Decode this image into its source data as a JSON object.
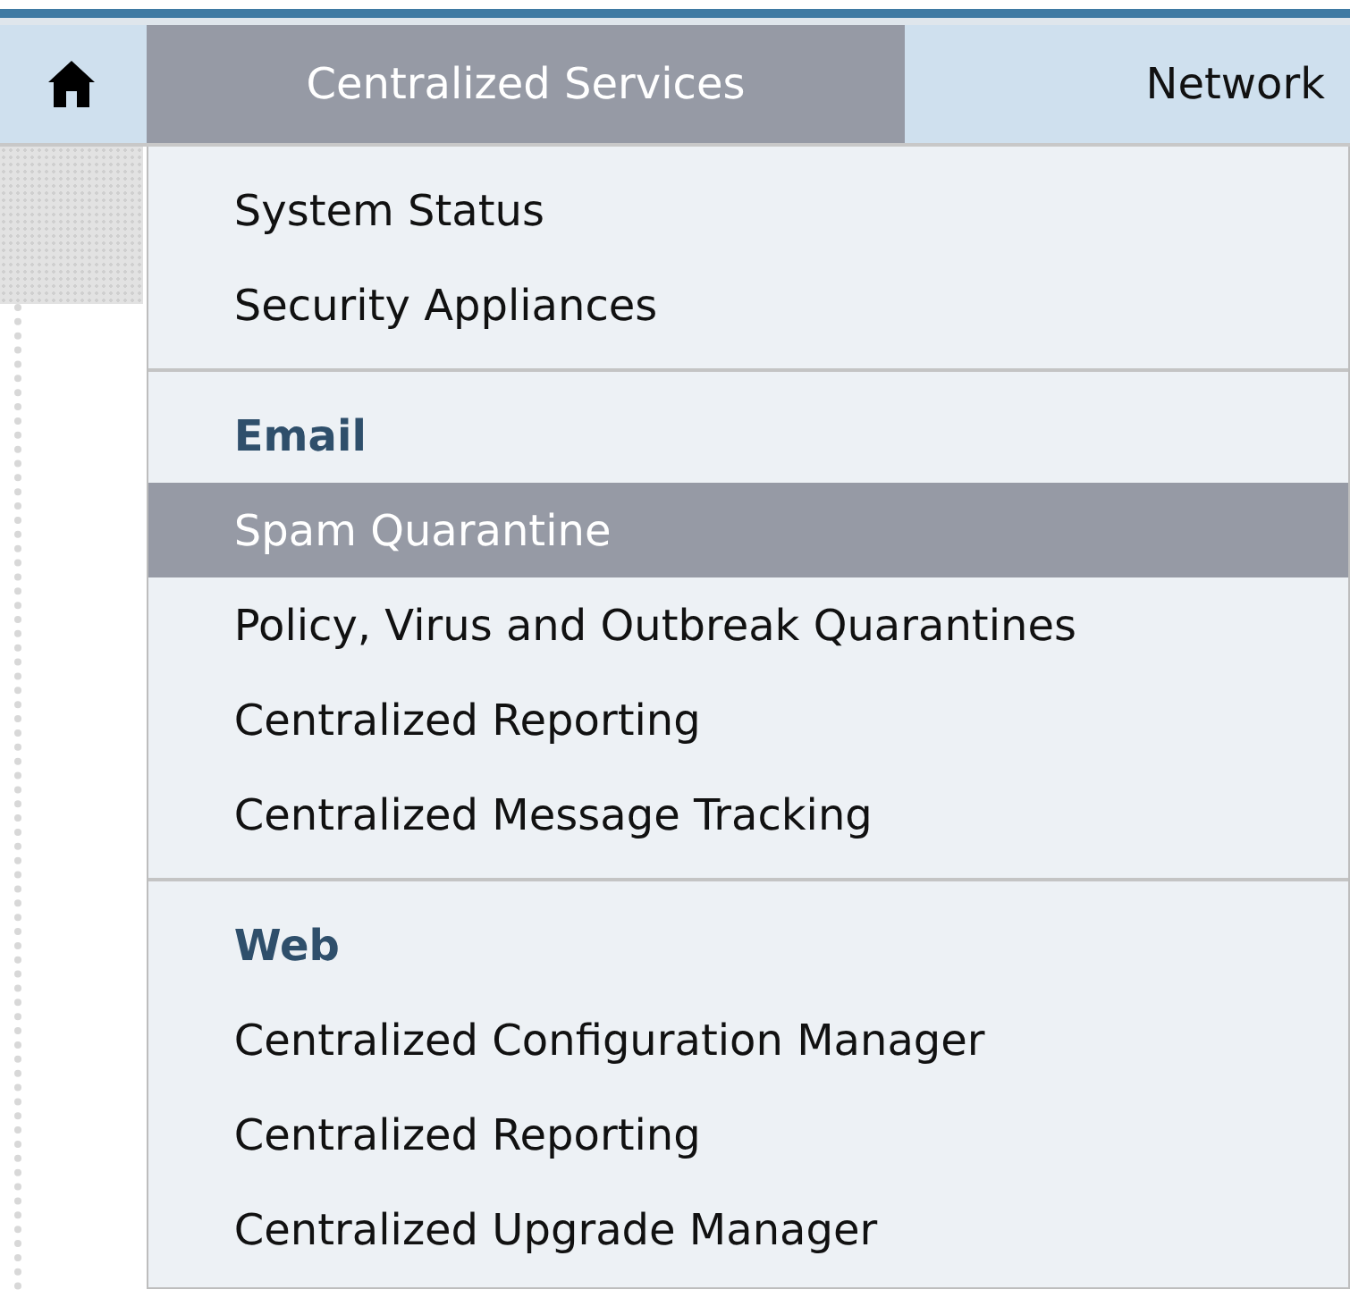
{
  "nav": {
    "tabs": [
      {
        "label": "Centralized Services",
        "selected": true
      },
      {
        "label": "Network",
        "selected": false
      }
    ]
  },
  "menu": {
    "sections": [
      {
        "items": [
          {
            "label": "System Status",
            "selected": false
          },
          {
            "label": "Security Appliances",
            "selected": false
          }
        ]
      },
      {
        "heading": "Email",
        "items": [
          {
            "label": "Spam Quarantine",
            "selected": true
          },
          {
            "label": "Policy, Virus and Outbreak Quarantines",
            "selected": false
          },
          {
            "label": "Centralized Reporting",
            "selected": false
          },
          {
            "label": "Centralized Message Tracking",
            "selected": false
          }
        ]
      },
      {
        "heading": "Web",
        "items": [
          {
            "label": "Centralized Configuration Manager",
            "selected": false
          },
          {
            "label": "Centralized Reporting",
            "selected": false
          },
          {
            "label": "Centralized Upgrade Manager",
            "selected": false
          }
        ]
      }
    ]
  }
}
